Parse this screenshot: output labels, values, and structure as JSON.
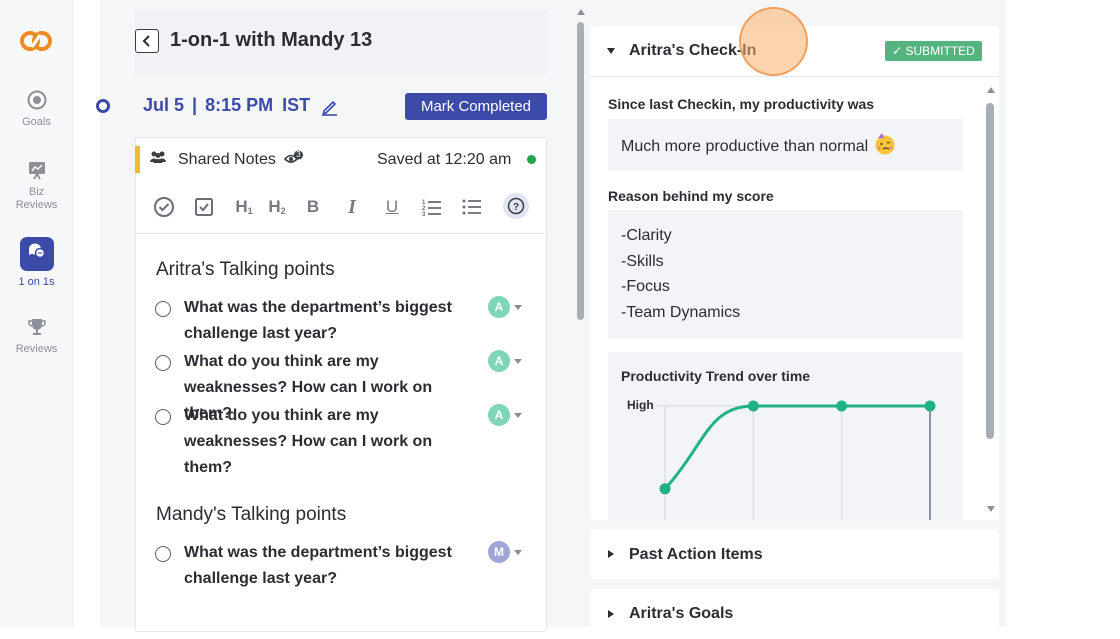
{
  "sidebar": {
    "items": [
      {
        "label": "Goals",
        "icon": "target-icon"
      },
      {
        "label": "Biz\nReviews",
        "icon": "chart-board-icon"
      },
      {
        "label": "1 on 1s",
        "icon": "chat-bubbles-icon",
        "active": true
      },
      {
        "label": "Reviews",
        "icon": "trophy-icon"
      }
    ]
  },
  "meeting": {
    "title": "1-on-1 with Mandy 13",
    "date": "Jul 5",
    "time": "8:15 PM",
    "timezone": "IST",
    "mark_completed_label": "Mark Completed"
  },
  "notes": {
    "title": "Shared Notes",
    "viewers_badge": "3",
    "saved_text": "Saved at 12:20 am",
    "toolbar": [
      "check-circle-icon",
      "checkbox-icon",
      "heading-1-icon",
      "heading-2-icon",
      "bold-icon",
      "italic-icon",
      "underline-icon",
      "ordered-list-icon",
      "bullet-list-icon",
      "help-icon"
    ]
  },
  "talking_points": [
    {
      "section_title": "Aritra's Talking points",
      "items": [
        {
          "text": "What was the department’s biggest challenge last year?",
          "avatar": "A"
        },
        {
          "text": "What do you think are my weaknesses? How can I work on them?",
          "avatar": "A"
        },
        {
          "text": "What do you think are my weaknesses? How can I work on them?",
          "avatar": "A"
        }
      ]
    },
    {
      "section_title": "Mandy's Talking points",
      "items": [
        {
          "text": "What was the department’s biggest challenge last year?",
          "avatar": "M"
        }
      ]
    }
  ],
  "checkin": {
    "title": "Aritra's Check-In",
    "status": "✓ SUBMITTED",
    "q1_label": "Since last Checkin, my productivity was",
    "q1_answer": "Much more productive than normal",
    "q2_label": "Reason behind my score",
    "q2_answer_lines": [
      "-Clarity",
      "-Skills",
      "-Focus",
      "-Team Dynamics"
    ],
    "chart_title": "Productivity Trend over time"
  },
  "chart_data": {
    "type": "line",
    "title": "Productivity Trend over time",
    "y_tick_labels": [
      "High"
    ],
    "series": [
      {
        "values": [
          1,
          5,
          5,
          5
        ]
      }
    ],
    "ylim": [
      0,
      5
    ],
    "grid": true,
    "color": "#1fb283"
  },
  "panels": [
    {
      "title": "Past Action Items"
    },
    {
      "title": "Aritra's Goals"
    }
  ],
  "colors": {
    "brand": "#3c4aa8",
    "accent": "#f3bb2c",
    "submitted": "#55b37f",
    "line": "#1fb283",
    "avatar_a": "#7fd6b6",
    "avatar_m": "#9fa6d6"
  }
}
